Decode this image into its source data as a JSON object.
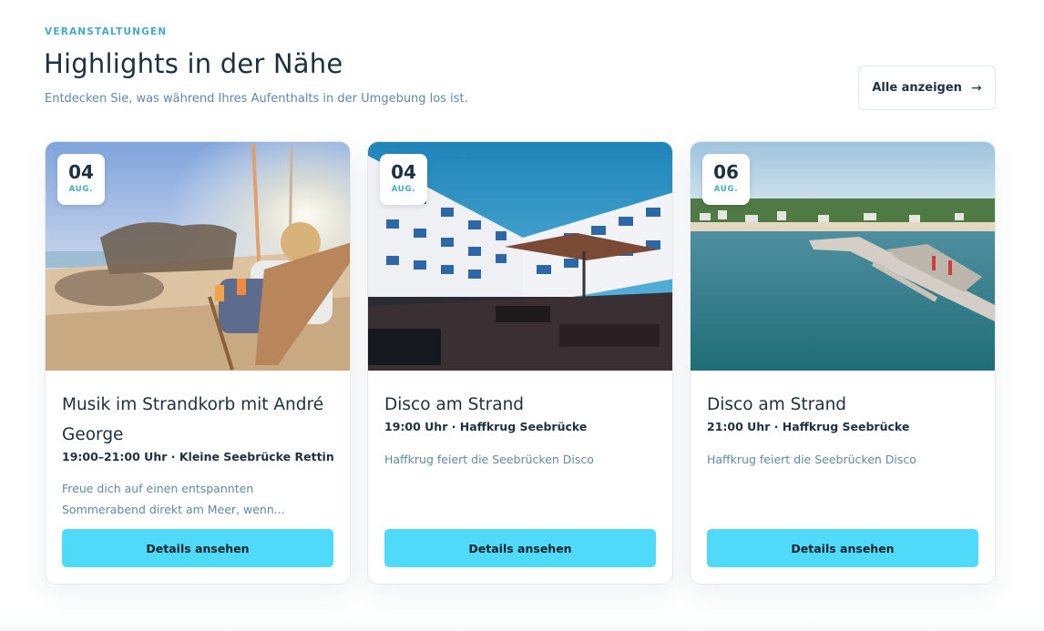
{
  "section": {
    "eyebrow": "VERANSTALTUNGEN",
    "title": "Highlights in der Nähe",
    "subtitle": "Entdecken Sie, was während Ihres Aufenthalts in der Umgebung los ist.",
    "all_button_label": "Alle anzeigen",
    "all_button_icon": "arrow-right-icon"
  },
  "events": [
    {
      "day": "04",
      "month": "AUG.",
      "title": "Musik im Strandkorb mit André George",
      "meta": "19:00–21:00 Uhr · Kleine Seebrücke Rettin",
      "description": "Freue dich auf einen entspannten Sommerabend direkt am Meer, wenn...",
      "button_label": "Details ansehen"
    },
    {
      "day": "04",
      "month": "AUG.",
      "title": "Disco am Strand",
      "meta": "19:00 Uhr · Haffkrug Seebrücke",
      "description": "Haffkrug feiert die Seebrücken Disco",
      "button_label": "Details ansehen"
    },
    {
      "day": "06",
      "month": "AUG.",
      "title": "Disco am Strand",
      "meta": "21:00 Uhr · Haffkrug Seebrücke",
      "description": "Haffkrug feiert die Seebrücken Disco",
      "button_label": "Details ansehen"
    }
  ],
  "colors": {
    "accent": "#43aac9",
    "button": "#50dafa",
    "heading": "#1d3140",
    "muted": "#5f8aa0"
  }
}
